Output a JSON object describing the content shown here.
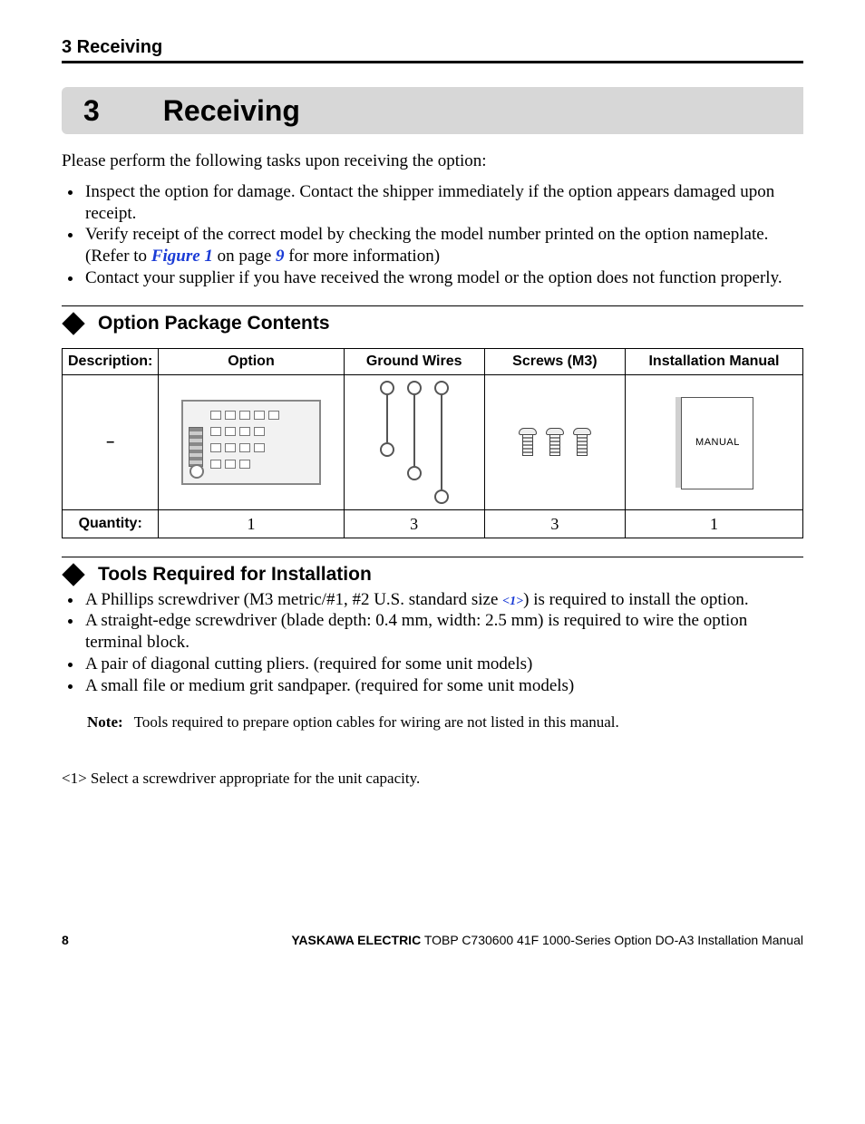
{
  "header": {
    "label": "3  Receiving"
  },
  "chapter": {
    "num": "3",
    "title": "Receiving"
  },
  "intro": "Please perform the following tasks upon receiving the option:",
  "bullets_top": [
    "Inspect the option for damage. Contact the shipper immediately if the option appears damaged upon receipt.",
    "Verify receipt of the correct model by checking the model number printed on the option nameplate. (Refer to ",
    "Contact your supplier if you have received the wrong model or the option does not function properly."
  ],
  "fig_ref": {
    "label": "Figure 1",
    "middle": " on page ",
    "page": "9",
    "close": " for more information)"
  },
  "section1": {
    "title": "Option Package Contents"
  },
  "table": {
    "head": {
      "desc": "Description:",
      "c1": "Option",
      "c2": "Ground Wires",
      "c3": "Screws (M3)",
      "c4": "Installation Manual"
    },
    "row_dash": "–",
    "manual_word": "MANUAL",
    "qty_label": "Quantity:",
    "qty": {
      "c1": "1",
      "c2": "3",
      "c3": "3",
      "c4": "1"
    }
  },
  "section2": {
    "title": "Tools Required for Installation"
  },
  "bullets_tools": {
    "b1a": "A Phillips screwdriver (M3 metric/#1, #2 U.S. standard size ",
    "b1_ref": "<1>",
    "b1b": ") is required to install the option.",
    "b2": "A straight-edge screwdriver (blade depth: 0.4 mm, width: 2.5 mm) is required to wire the option terminal block.",
    "b3": "A pair of diagonal cutting pliers. (required for some unit models)",
    "b4": "A small file or medium grit sandpaper. (required for some unit models)"
  },
  "note": {
    "label": "Note:",
    "text": "Tools required to prepare option cables for wiring are not listed in this manual."
  },
  "footnote": "<1> Select a screwdriver appropriate for the unit capacity.",
  "footer": {
    "page": "8",
    "company": "YASKAWA ELECTRIC",
    "doc": " TOBP C730600 41F 1000-Series Option DO-A3 Installation Manual"
  }
}
